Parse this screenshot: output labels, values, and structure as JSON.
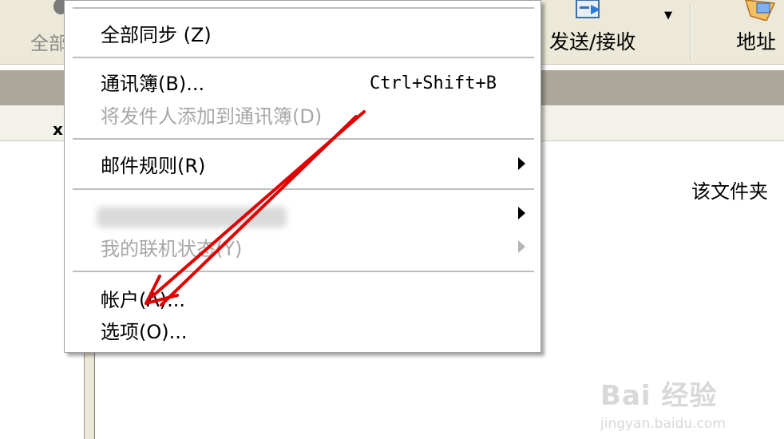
{
  "toolbar": {
    "left_label": "全部",
    "send_receive_label": "发送/接收",
    "address_label": "地址"
  },
  "left_pane": {
    "close_glyph": "x"
  },
  "content": {
    "message": "该文件夹"
  },
  "menu": {
    "sync_all": "全部同步 (Z)",
    "address_book": "通讯簿(B)...",
    "address_book_shortcut": "Ctrl+Shift+B",
    "add_sender": "将发件人添加到通讯簿(D)",
    "message_rules": "邮件规则(R)",
    "my_online_status": "我的联机状态(Y)",
    "accounts": "帐户(A)...",
    "options": "选项(O)..."
  },
  "watermark": {
    "brand": "Bai 经验",
    "url": "jingyan.baidu.com"
  },
  "colors": {
    "annotation": "#e00000",
    "toolbar_bg": "#ece9d8",
    "disabled_text": "#a7a7a7"
  }
}
